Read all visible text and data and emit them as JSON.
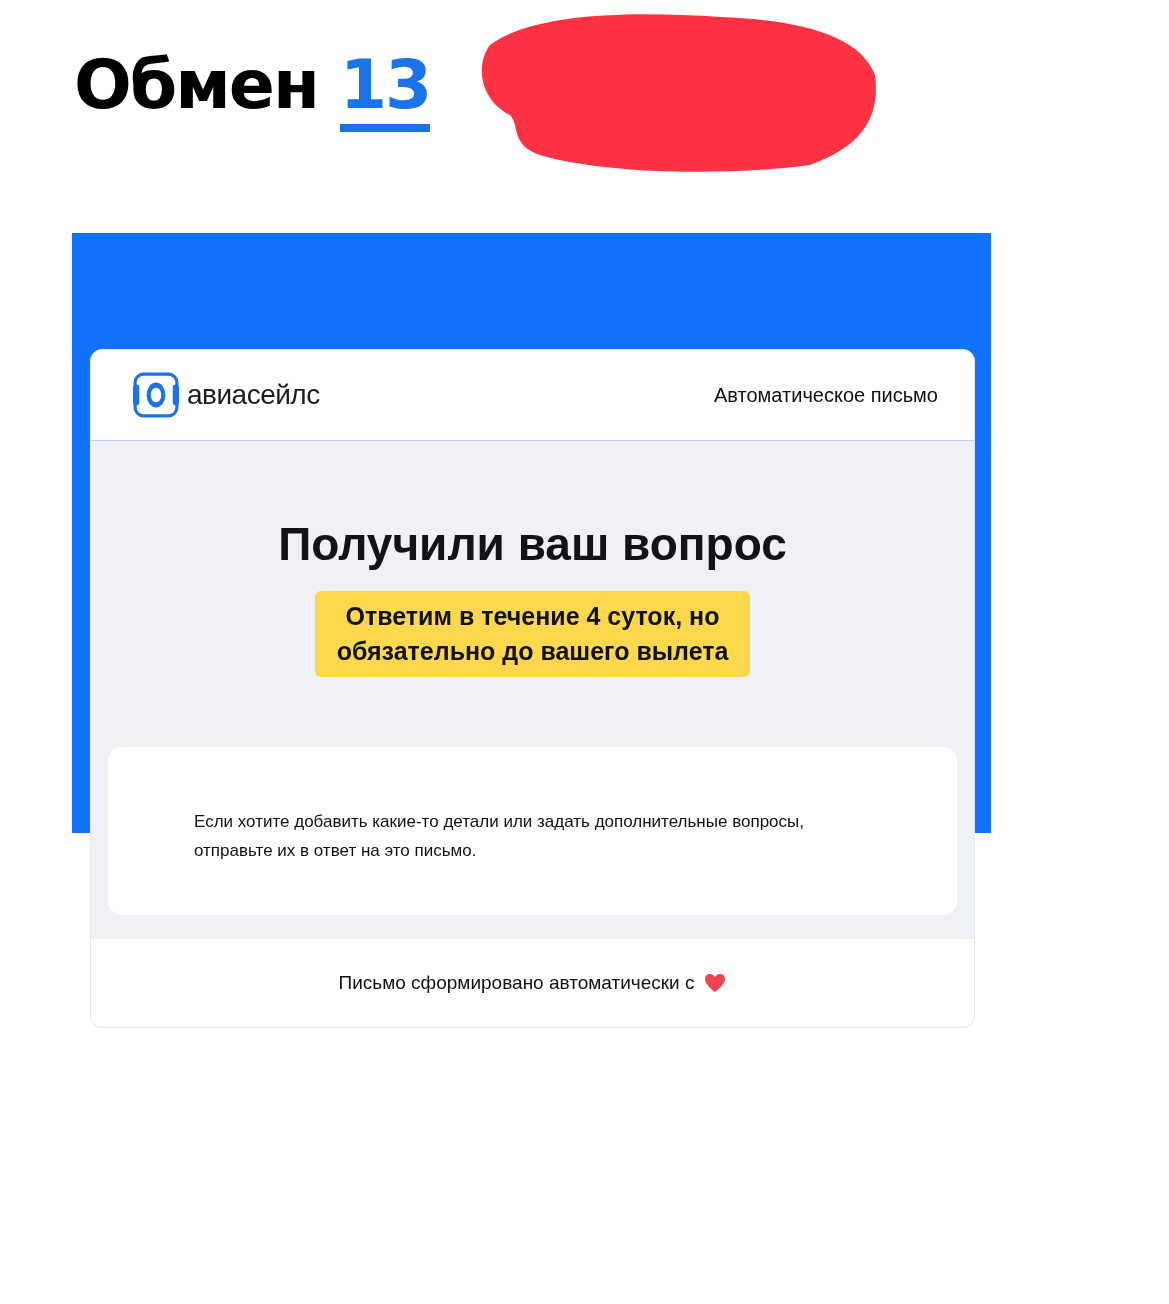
{
  "headline": {
    "text": "Обмен",
    "link": "13"
  },
  "email": {
    "brand": "авиасейлс",
    "header_note": "Автоматическое письмо",
    "title": "Получили ваш вопрос",
    "notice": "Ответим в течение 4 суток, но обязательно до вашего вылета",
    "message": "Если хотите добавить какие-то детали или задать дополнительные вопросы, отправьте их в ответ на это письмо.",
    "footer": "Письмо сформировано автоматически с"
  }
}
